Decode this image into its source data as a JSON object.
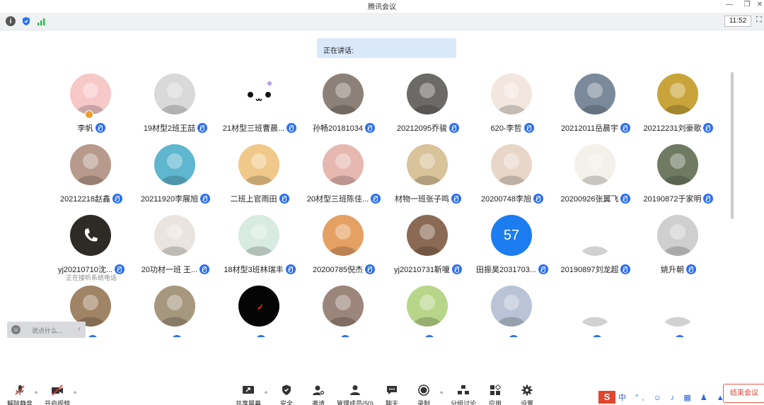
{
  "window": {
    "title": "腾讯会议"
  },
  "status_bar": {
    "clock": "11:52",
    "icons": [
      "info-icon",
      "shield-icon",
      "signal-icon"
    ]
  },
  "speaking": {
    "label": "正在讲话:"
  },
  "participants": [
    {
      "name": "李帆",
      "avatar": "pink-blob",
      "bg": "#f6c8c8",
      "host": true
    },
    {
      "name": "19材型2班王喆",
      "avatar": "mask",
      "bg": "#d9d9d9"
    },
    {
      "name": "21材型三班曹晨...",
      "avatar": "kaomoji",
      "bg": "#ffffff"
    },
    {
      "name": "孙畅20181034",
      "avatar": "photo",
      "bg": "#8c8178"
    },
    {
      "name": "20212095乔骏",
      "avatar": "photo",
      "bg": "#6c6a67"
    },
    {
      "name": "620-李哲",
      "avatar": "flag-kid",
      "bg": "#f2e6df"
    },
    {
      "name": "20212011岳晨宇",
      "avatar": "rider",
      "bg": "#7b8a9b"
    },
    {
      "name": "20212231刘豪歌",
      "avatar": "gold",
      "bg": "#c9a43a"
    },
    {
      "name": "20212218赵鑫",
      "avatar": "photo",
      "bg": "#b79a8c"
    },
    {
      "name": "20211920李展旭",
      "avatar": "astronaut",
      "bg": "#5fb7cf"
    },
    {
      "name": "二班上官雨田",
      "avatar": "fox",
      "bg": "#f0c98a"
    },
    {
      "name": "20材型三班陈佳...",
      "avatar": "photo",
      "bg": "#e6b8b0"
    },
    {
      "name": "材物一班张子鸣",
      "avatar": "cat",
      "bg": "#d8c39a"
    },
    {
      "name": "20200748李旭",
      "avatar": "girl",
      "bg": "#e8d7c9"
    },
    {
      "name": "20200926张翼飞",
      "avatar": "sketch",
      "bg": "#f4f0ea"
    },
    {
      "name": "20190872于家明",
      "avatar": "photo",
      "bg": "#6f7a62"
    },
    {
      "name": "yj20210710沈...",
      "avatar": "phone",
      "bg": "#2e2a26",
      "subtext": "正在接听系统电话"
    },
    {
      "name": "20功材一班 王...",
      "avatar": "puppy",
      "bg": "#e9e4df"
    },
    {
      "name": "18材型3班林瑞丰",
      "avatar": "boy",
      "bg": "#d8ebe2"
    },
    {
      "name": "20200785倪杰",
      "avatar": "orange",
      "bg": "#e5a063"
    },
    {
      "name": "yj20210731靳嗄",
      "avatar": "photo",
      "bg": "#8a6a54"
    },
    {
      "name": "田振昊2031703...",
      "avatar": "number",
      "bg": "#1c7cf0",
      "number": "57"
    },
    {
      "name": "20190897刘龙超",
      "avatar": "fairy",
      "bg": "#ffffff"
    },
    {
      "name": "姚升朝",
      "avatar": "bw",
      "bg": "#cfcfcf"
    },
    {
      "name": "",
      "avatar": "photo",
      "bg": "#a08466"
    },
    {
      "name": "",
      "avatar": "photo",
      "bg": "#a6977f"
    },
    {
      "name": "",
      "avatar": "moon",
      "bg": "#050505"
    },
    {
      "name": "",
      "avatar": "photo",
      "bg": "#9c857a"
    },
    {
      "name": "",
      "avatar": "frog",
      "bg": "#b7d68a"
    },
    {
      "name": "",
      "avatar": "silhouette",
      "bg": "#b9c4d6"
    },
    {
      "name": "",
      "avatar": "panda",
      "bg": "#ffffff"
    },
    {
      "name": "",
      "avatar": "sketch2",
      "bg": "#ffffff"
    }
  ],
  "chat": {
    "placeholder": "说点什么..."
  },
  "toolbar": {
    "items": [
      {
        "label": "解除静音",
        "icon": "mic-muted-icon"
      },
      {
        "label": "开启视频",
        "icon": "camera-off-icon"
      },
      {
        "label": "共享屏幕",
        "icon": "share-screen-icon"
      },
      {
        "label": "安全",
        "icon": "shield-icon"
      },
      {
        "label": "邀请",
        "icon": "invite-icon"
      },
      {
        "label": "管理成员(50)",
        "icon": "members-icon"
      },
      {
        "label": "聊天",
        "icon": "chat-icon"
      },
      {
        "label": "录制",
        "icon": "record-icon"
      },
      {
        "label": "分组讨论",
        "icon": "breakout-icon"
      },
      {
        "label": "应用",
        "icon": "apps-icon"
      },
      {
        "label": "设置",
        "icon": "gear-icon"
      }
    ],
    "end": "结束会议"
  },
  "ime": {
    "brand": "S",
    "items": "中 °, ☺ ♪ ▦ ♟ ▲ ▦"
  },
  "colors": {
    "accent": "#2c6ff0",
    "danger": "#e03b2f",
    "banner": "#dae8fb"
  }
}
